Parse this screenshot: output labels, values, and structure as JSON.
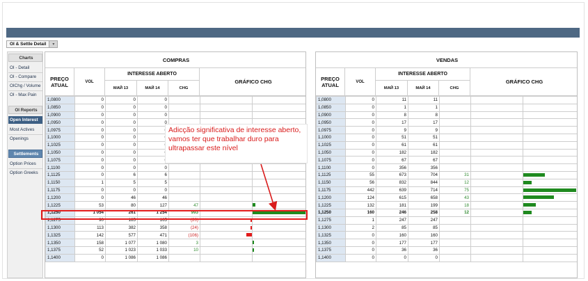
{
  "toolbar": {
    "view_select": "OI & Settle Detail"
  },
  "sidebar": {
    "charts_header": "Charts",
    "chart_items": [
      "OI - Detail",
      "OI - Compare",
      "OIChg / Volume",
      "OI - Max Pain"
    ],
    "reports_header": "OI Reports",
    "report_items": [
      "Open Interest",
      "Most Actives",
      "Openings"
    ],
    "active_report": "Open Interest",
    "settlements_header": "Settlements",
    "settlement_items": [
      "Option Prices",
      "Option Greeks"
    ]
  },
  "columns": {
    "price": "PREÇO ATUAL",
    "vol": "VOL",
    "oi_group": "INTERESSE ABERTO",
    "may13": "МАЙ 13",
    "may14": "МАЙ 14",
    "chg": "CHG",
    "chart": "GRÁFICO CHG"
  },
  "panels": {
    "left_title": "COMPRAS",
    "right_title": "VENDAS"
  },
  "colors": {
    "nav": "#4e6883",
    "positive": "#1f8a1f",
    "negative": "#e21b1b",
    "annotation": "#d91c1c"
  },
  "compras_rows": [
    {
      "price": "1,0800",
      "vol": "0",
      "may13": "0",
      "may14": "0",
      "chg": "",
      "chg_value": 0
    },
    {
      "price": "1,0850",
      "vol": "0",
      "may13": "0",
      "may14": "0",
      "chg": "",
      "chg_value": 0
    },
    {
      "price": "1,0900",
      "vol": "0",
      "may13": "0",
      "may14": "0",
      "chg": "",
      "chg_value": 0
    },
    {
      "price": "1,0950",
      "vol": "0",
      "may13": "0",
      "may14": "0",
      "chg": "",
      "chg_value": 0
    },
    {
      "price": "1,0975",
      "vol": "0",
      "may13": "0",
      "may14": "0",
      "chg": "",
      "chg_value": 0
    },
    {
      "price": "1,1000",
      "vol": "0",
      "may13": "0",
      "may14": "0",
      "chg": "",
      "chg_value": 0
    },
    {
      "price": "1,1025",
      "vol": "0",
      "may13": "0",
      "may14": "0",
      "chg": "",
      "chg_value": 0
    },
    {
      "price": "1,1050",
      "vol": "0",
      "may13": "0",
      "may14": "0",
      "chg": "",
      "chg_value": 0
    },
    {
      "price": "1,1075",
      "vol": "0",
      "may13": "0",
      "may14": "0",
      "chg": "",
      "chg_value": 0
    },
    {
      "price": "1,1100",
      "vol": "0",
      "may13": "0",
      "may14": "0",
      "chg": "",
      "chg_value": 0
    },
    {
      "price": "1,1125",
      "vol": "0",
      "may13": "6",
      "may14": "6",
      "chg": "",
      "chg_value": 0
    },
    {
      "price": "1,1150",
      "vol": "1",
      "may13": "5",
      "may14": "5",
      "chg": "",
      "chg_value": 0
    },
    {
      "price": "1,1175",
      "vol": "0",
      "may13": "0",
      "may14": "0",
      "chg": "",
      "chg_value": 0
    },
    {
      "price": "1,1200",
      "vol": "0",
      "may13": "46",
      "may14": "46",
      "chg": "",
      "chg_value": 0
    },
    {
      "price": "1,1225",
      "vol": "53",
      "may13": "80",
      "may14": "127",
      "chg": "47",
      "chg_value": 47
    },
    {
      "price": "1,1250",
      "vol": "1 054",
      "may13": "261",
      "may14": "1 254",
      "chg": "993",
      "chg_value": 993
    },
    {
      "price": "1,1275",
      "vol": "90",
      "may13": "185",
      "may14": "165",
      "chg": "(20)",
      "chg_value": -20
    },
    {
      "price": "1,1300",
      "vol": "113",
      "may13": "382",
      "may14": "358",
      "chg": "(24)",
      "chg_value": -24
    },
    {
      "price": "1,1325",
      "vol": "142",
      "may13": "577",
      "may14": "471",
      "chg": "(106)",
      "chg_value": -106
    },
    {
      "price": "1,1350",
      "vol": "158",
      "may13": "1 077",
      "may14": "1 080",
      "chg": "3",
      "chg_value": 3
    },
    {
      "price": "1,1375",
      "vol": "52",
      "may13": "1 023",
      "may14": "1 033",
      "chg": "10",
      "chg_value": 10
    },
    {
      "price": "1,1400",
      "vol": "0",
      "may13": "1 086",
      "may14": "1 086",
      "chg": "",
      "chg_value": 0
    }
  ],
  "vendas_rows": [
    {
      "price": "1,0800",
      "vol": "0",
      "may13": "11",
      "may14": "11",
      "chg": "",
      "chg_value": 0
    },
    {
      "price": "1,0850",
      "vol": "0",
      "may13": "1",
      "may14": "1",
      "chg": "",
      "chg_value": 0
    },
    {
      "price": "1,0900",
      "vol": "0",
      "may13": "8",
      "may14": "8",
      "chg": "",
      "chg_value": 0
    },
    {
      "price": "1,0950",
      "vol": "0",
      "may13": "17",
      "may14": "17",
      "chg": "",
      "chg_value": 0
    },
    {
      "price": "1,0975",
      "vol": "0",
      "may13": "9",
      "may14": "9",
      "chg": "",
      "chg_value": 0
    },
    {
      "price": "1,1000",
      "vol": "0",
      "may13": "51",
      "may14": "51",
      "chg": "",
      "chg_value": 0
    },
    {
      "price": "1,1025",
      "vol": "0",
      "may13": "61",
      "may14": "61",
      "chg": "",
      "chg_value": 0
    },
    {
      "price": "1,1050",
      "vol": "0",
      "may13": "182",
      "may14": "182",
      "chg": "",
      "chg_value": 0
    },
    {
      "price": "1,1075",
      "vol": "0",
      "may13": "67",
      "may14": "67",
      "chg": "",
      "chg_value": 0
    },
    {
      "price": "1,1100",
      "vol": "0",
      "may13": "356",
      "may14": "356",
      "chg": "",
      "chg_value": 0
    },
    {
      "price": "1,1125",
      "vol": "55",
      "may13": "673",
      "may14": "704",
      "chg": "31",
      "chg_value": 31
    },
    {
      "price": "1,1150",
      "vol": "56",
      "may13": "832",
      "may14": "844",
      "chg": "12",
      "chg_value": 12
    },
    {
      "price": "1,1175",
      "vol": "442",
      "may13": "639",
      "may14": "714",
      "chg": "75",
      "chg_value": 75
    },
    {
      "price": "1,1200",
      "vol": "124",
      "may13": "615",
      "may14": "658",
      "chg": "43",
      "chg_value": 43
    },
    {
      "price": "1,1225",
      "vol": "132",
      "may13": "181",
      "may14": "199",
      "chg": "18",
      "chg_value": 18
    },
    {
      "price": "1,1250",
      "vol": "160",
      "may13": "246",
      "may14": "258",
      "chg": "12",
      "chg_value": 12
    },
    {
      "price": "1,1275",
      "vol": "1",
      "may13": "247",
      "may14": "247",
      "chg": "",
      "chg_value": 0
    },
    {
      "price": "1,1300",
      "vol": "2",
      "may13": "85",
      "may14": "85",
      "chg": "",
      "chg_value": 0
    },
    {
      "price": "1,1325",
      "vol": "0",
      "may13": "160",
      "may14": "160",
      "chg": "",
      "chg_value": 0
    },
    {
      "price": "1,1350",
      "vol": "0",
      "may13": "177",
      "may14": "177",
      "chg": "",
      "chg_value": 0
    },
    {
      "price": "1,1375",
      "vol": "0",
      "may13": "36",
      "may14": "36",
      "chg": "",
      "chg_value": 0
    },
    {
      "price": "1,1400",
      "vol": "0",
      "may13": "0",
      "may14": "0",
      "chg": "",
      "chg_value": 0
    }
  ],
  "highlight_row": "1,1250",
  "annotation": {
    "text": "Adicção significativa de interesse aberto, vamos ter que trabalhar duro para ultrapassar este nível"
  }
}
